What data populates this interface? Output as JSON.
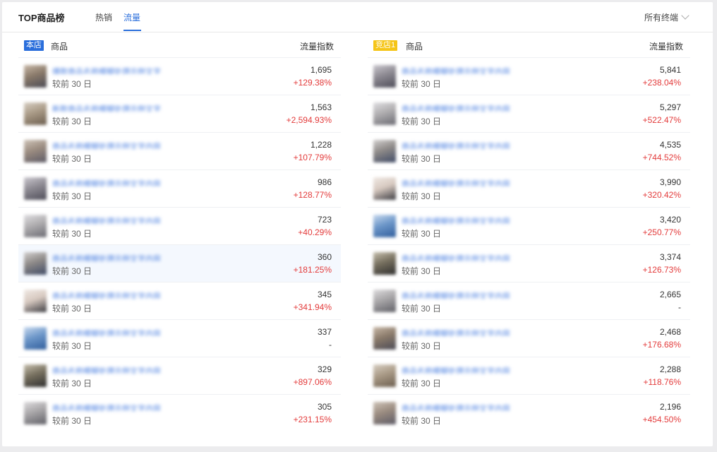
{
  "header": {
    "title": "TOP商品榜",
    "tabs": [
      "热销",
      "流量"
    ],
    "terminal": "所有终端"
  },
  "colors": {
    "accent": "#2a6edb",
    "up": "#e33b3b",
    "shop_badge": "#2a6edb",
    "rival_badge": "#f5c518"
  },
  "panels": [
    {
      "badge": "本店",
      "col_goods": "商品",
      "col_index": "流量指数",
      "rows": [
        {
          "name": "爆款商品名称模糊处理示例文字",
          "compare": "较前 30 日",
          "value": "1,695",
          "change": "+129.38%"
        },
        {
          "name": "新款商品名称模糊处理示例文字",
          "compare": "较前 30 日",
          "value": "1,563",
          "change": "+2,594.93%"
        },
        {
          "name": "商品名称模糊处理示例文字内容",
          "compare": "较前 30 日",
          "value": "1,228",
          "change": "+107.79%"
        },
        {
          "name": "商品名称模糊处理示例文字内容",
          "compare": "较前 30 日",
          "value": "986",
          "change": "+128.77%"
        },
        {
          "name": "商品名称模糊处理示例文字内容",
          "compare": "较前 30 日",
          "value": "723",
          "change": "+40.29%"
        },
        {
          "name": "商品名称模糊处理示例文字内容",
          "compare": "较前 30 日",
          "value": "360",
          "change": "+181.25%"
        },
        {
          "name": "商品名称模糊处理示例文字内容",
          "compare": "较前 30 日",
          "value": "345",
          "change": "+341.94%"
        },
        {
          "name": "商品名称模糊处理示例文字内容",
          "compare": "较前 30 日",
          "value": "337",
          "change": "-"
        },
        {
          "name": "商品名称模糊处理示例文字内容",
          "compare": "较前 30 日",
          "value": "329",
          "change": "+897.06%"
        },
        {
          "name": "商品名称模糊处理示例文字内容",
          "compare": "较前 30 日",
          "value": "305",
          "change": "+231.15%"
        }
      ]
    },
    {
      "badge": "竞店1",
      "col_goods": "商品",
      "col_index": "流量指数",
      "rows": [
        {
          "name": "商品名称模糊处理示例文字内容",
          "compare": "较前 30 日",
          "value": "5,841",
          "change": "+238.04%"
        },
        {
          "name": "商品名称模糊处理示例文字内容",
          "compare": "较前 30 日",
          "value": "5,297",
          "change": "+522.47%"
        },
        {
          "name": "商品名称模糊处理示例文字内容",
          "compare": "较前 30 日",
          "value": "4,535",
          "change": "+744.52%"
        },
        {
          "name": "商品名称模糊处理示例文字内容",
          "compare": "较前 30 日",
          "value": "3,990",
          "change": "+320.42%"
        },
        {
          "name": "商品名称模糊处理示例文字内容",
          "compare": "较前 30 日",
          "value": "3,420",
          "change": "+250.77%"
        },
        {
          "name": "商品名称模糊处理示例文字内容",
          "compare": "较前 30 日",
          "value": "3,374",
          "change": "+126.73%"
        },
        {
          "name": "商品名称模糊处理示例文字内容",
          "compare": "较前 30 日",
          "value": "2,665",
          "change": "-"
        },
        {
          "name": "商品名称模糊处理示例文字内容",
          "compare": "较前 30 日",
          "value": "2,468",
          "change": "+176.68%"
        },
        {
          "name": "商品名称模糊处理示例文字内容",
          "compare": "较前 30 日",
          "value": "2,288",
          "change": "+118.76%"
        },
        {
          "name": "商品名称模糊处理示例文字内容",
          "compare": "较前 30 日",
          "value": "2,196",
          "change": "+454.50%"
        }
      ]
    }
  ]
}
